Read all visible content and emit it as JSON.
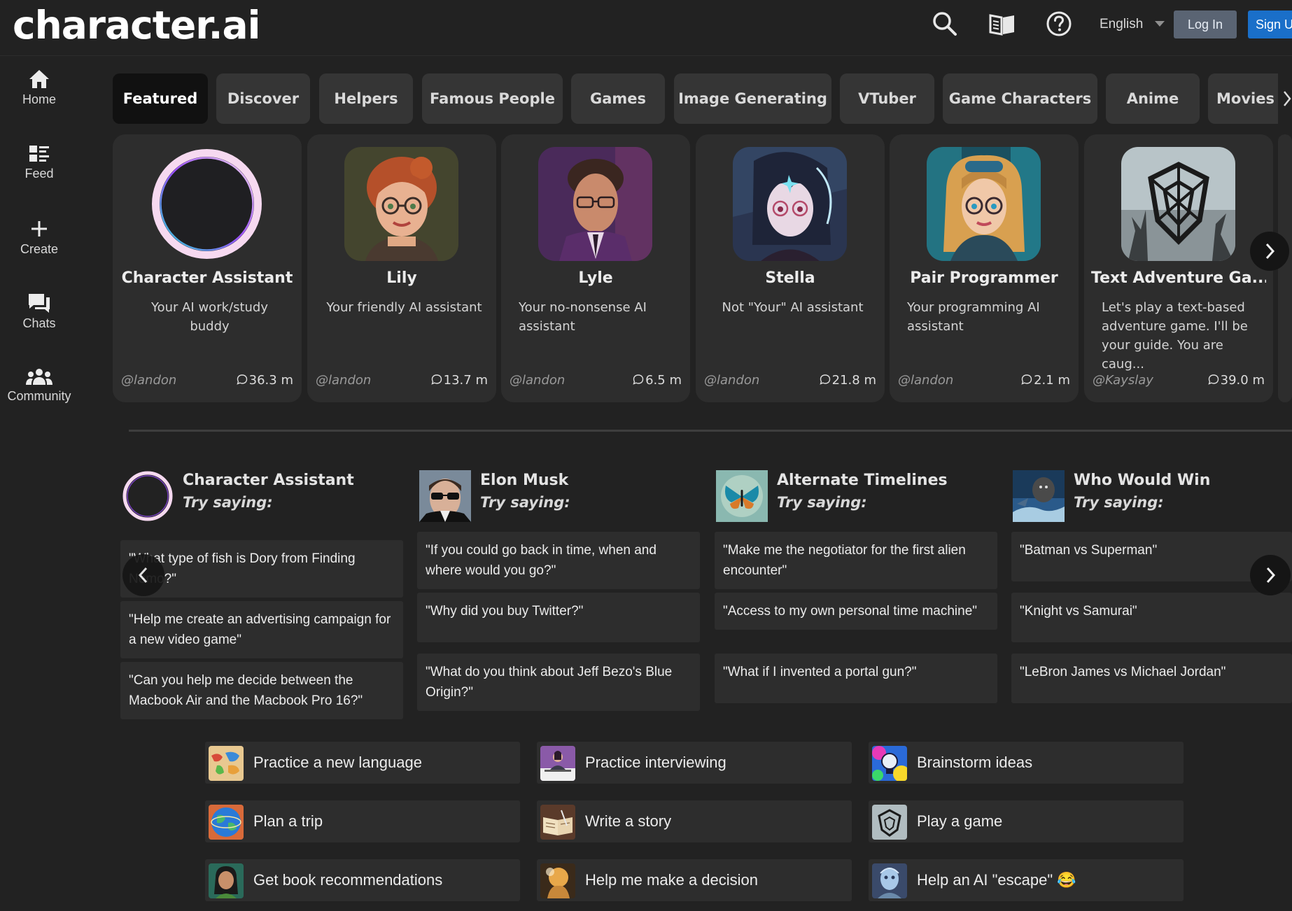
{
  "header": {
    "logo": "character.ai",
    "language": "English",
    "login_label": "Log In",
    "signup_label": "Sign U",
    "icons": [
      "search-icon",
      "book-icon",
      "help-icon"
    ]
  },
  "sidebar": {
    "items": [
      {
        "label": "Home",
        "icon": "home-icon"
      },
      {
        "label": "Feed",
        "icon": "feed-icon"
      },
      {
        "label": "Create",
        "icon": "plus-icon"
      },
      {
        "label": "Chats",
        "icon": "chat-icon"
      },
      {
        "label": "Community",
        "icon": "community-icon"
      }
    ]
  },
  "tabs": [
    {
      "label": "Featured"
    },
    {
      "label": "Discover"
    },
    {
      "label": "Helpers"
    },
    {
      "label": "Famous People"
    },
    {
      "label": "Games"
    },
    {
      "label": "Image Generating"
    },
    {
      "label": "VTuber"
    },
    {
      "label": "Game Characters"
    },
    {
      "label": "Anime"
    },
    {
      "label": "Movies"
    }
  ],
  "cards": [
    {
      "title": "Character Assistant",
      "description": "Your AI work/study buddy",
      "author": "@landon",
      "count": "36.3 m"
    },
    {
      "title": "Lily",
      "description": "Your friendly AI assistant",
      "author": "@landon",
      "count": "13.7 m"
    },
    {
      "title": "Lyle",
      "description": "Your no-nonsense AI assistant",
      "author": "@landon",
      "count": "6.5 m"
    },
    {
      "title": "Stella",
      "description": "Not \"Your\" AI assistant",
      "author": "@landon",
      "count": "21.8 m"
    },
    {
      "title": "Pair Programmer",
      "description": "Your programming AI assistant",
      "author": "@landon",
      "count": "2.1 m"
    },
    {
      "title": "Text Adventure Ga...",
      "description": "Let's play a text-based adventure game. I'll be your guide. You are caug...",
      "author": "@Kayslay",
      "count": "39.0 m"
    }
  ],
  "try_sections": [
    {
      "name": "Character Assistant",
      "subtitle": "Try saying:",
      "prompts": [
        "\"What type of fish is Dory from Finding Nemo?\"",
        "\"Help me create an advertising campaign for a new video game\"",
        "\"Can you help me decide between the Macbook Air and the Macbook Pro 16?\""
      ]
    },
    {
      "name": "Elon Musk",
      "subtitle": "Try saying:",
      "prompts": [
        "\"If you could go back in time, when and where would you go?\"",
        "\"Why did you buy Twitter?\"",
        "\"What do you think about Jeff Bezo's Blue Origin?\""
      ]
    },
    {
      "name": "Alternate Timelines",
      "subtitle": "Try saying:",
      "prompts": [
        "\"Make me the negotiator for the first alien encounter\"",
        "\"Access to my own personal time machine\"",
        "\"What if I invented a portal gun?\""
      ]
    },
    {
      "name": "Who Would Win",
      "subtitle": "Try saying:",
      "prompts": [
        "\"Batman vs Superman\"",
        "\"Knight vs Samurai\"",
        "\"LeBron James vs Michael Jordan\""
      ]
    }
  ],
  "activities": [
    {
      "label": "Practice a new language"
    },
    {
      "label": "Practice interviewing"
    },
    {
      "label": "Brainstorm ideas"
    },
    {
      "label": "Plan a trip"
    },
    {
      "label": "Write a story"
    },
    {
      "label": "Play a game"
    },
    {
      "label": "Get book recommendations"
    },
    {
      "label": "Help me make a decision"
    },
    {
      "label": "Help an AI \"escape\" 😂"
    }
  ],
  "colors": {
    "background": "#222222",
    "card": "#2d2d2d",
    "tab": "#353535",
    "tab_active": "#111111",
    "login_button": "#5a6473",
    "signup_button": "#1a6fc9",
    "assistant_ring": "#f6d9f0"
  }
}
